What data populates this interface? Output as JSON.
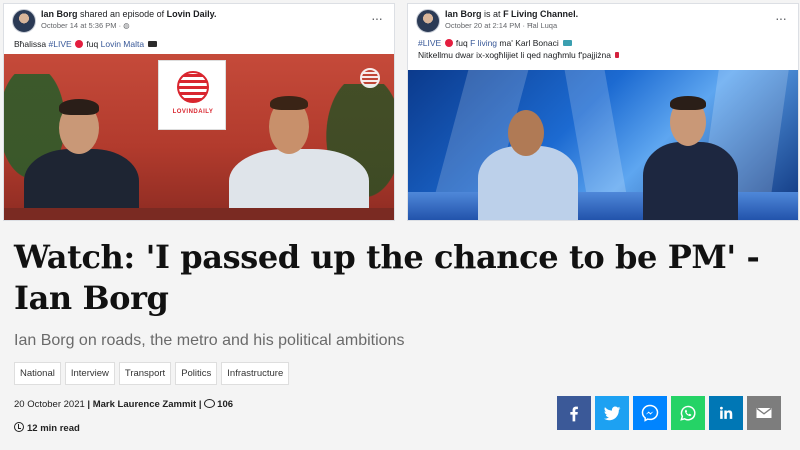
{
  "posts": [
    {
      "author": "Ian Borg",
      "action": "shared an episode of",
      "target": "Lovin Daily.",
      "date": "October 14 at 5:36 PM",
      "text_prefix": "Bħalissa",
      "text_live": "#LIVE",
      "text_mid": "fuq",
      "text_link": "Lovin Malta",
      "media_badge": "LOVINDAILY"
    },
    {
      "author": "Ian Borg",
      "action": "is at",
      "target": "F Living Channel.",
      "date": "October 20 at 2:14 PM · Ħal Luqa",
      "text_live": "#LIVE",
      "text_mid": "fuq",
      "text_link": "F living",
      "text_after": "ma'",
      "text_link2": "Karl Bonaci",
      "line2": "Nitkellmu dwar ix-xogħlijiet li qed nagħmlu f'pajjiżna"
    }
  ],
  "article": {
    "headline": "Watch: 'I passed up the chance to be PM' - Ian Borg",
    "subheadline": "Ian Borg on roads, the metro and his political ambitions",
    "tags": [
      "National",
      "Interview",
      "Transport",
      "Politics",
      "Infrastructure"
    ],
    "date": "20 October 2021",
    "separator": "|",
    "author": "Mark Laurence Zammit",
    "comments": "106",
    "read_time": "12 min read"
  },
  "share": [
    {
      "name": "facebook",
      "color": "#3b5998"
    },
    {
      "name": "twitter",
      "color": "#1da1f2"
    },
    {
      "name": "messenger",
      "color": "#0084ff"
    },
    {
      "name": "whatsapp",
      "color": "#25d366"
    },
    {
      "name": "linkedin",
      "color": "#0077b5"
    },
    {
      "name": "email",
      "color": "#7d7d7d"
    }
  ]
}
